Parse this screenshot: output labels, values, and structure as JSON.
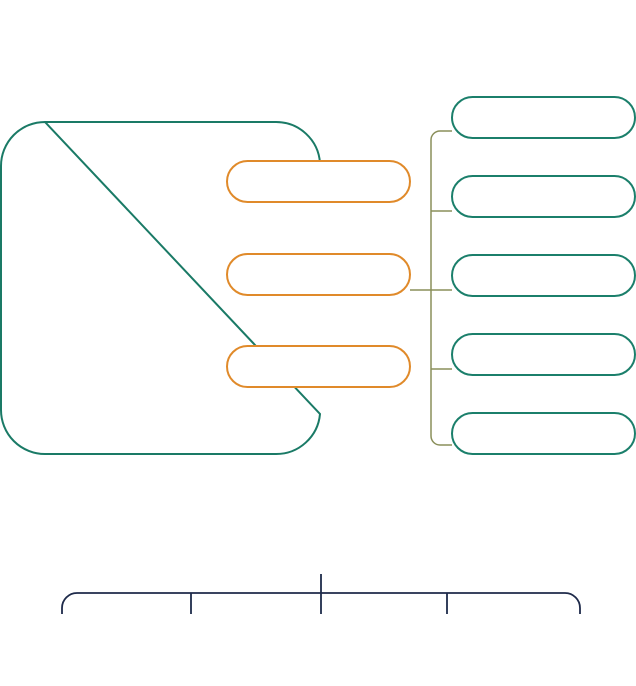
{
  "colors": {
    "background": "#ffffff",
    "container_green": "#1a7a66",
    "orange": "#e08a2a",
    "teal": "#1b7f6b",
    "bracket_olive": "#8a8f5a",
    "connector_orange_navy": "#c07a30",
    "navy": "#1e2a4a"
  },
  "left_pills": [
    {
      "label": ""
    },
    {
      "label": ""
    },
    {
      "label": ""
    }
  ],
  "right_pills": [
    {
      "label": ""
    },
    {
      "label": ""
    },
    {
      "label": ""
    },
    {
      "label": ""
    },
    {
      "label": ""
    }
  ],
  "bottom_branches": [
    {
      "label": ""
    },
    {
      "label": ""
    },
    {
      "label": ""
    },
    {
      "label": ""
    }
  ]
}
